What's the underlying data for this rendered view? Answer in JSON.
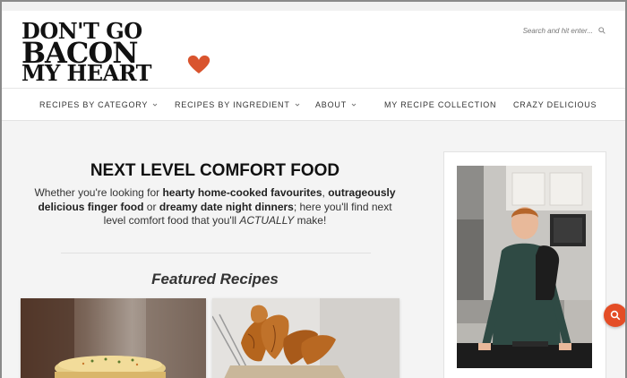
{
  "brand": {
    "logo_line1": "DON'T GO",
    "logo_line2": "BACON",
    "logo_line3": "MY HEART",
    "accent_color": "#d9542e"
  },
  "search": {
    "placeholder": "Search and hit enter...",
    "icon": "search-icon"
  },
  "nav": {
    "items": [
      {
        "label": "RECIPES BY CATEGORY",
        "has_dropdown": true
      },
      {
        "label": "RECIPES BY INGREDIENT",
        "has_dropdown": true
      },
      {
        "label": "ABOUT",
        "has_dropdown": true
      },
      {
        "label": "MY RECIPE COLLECTION",
        "has_dropdown": false
      },
      {
        "label": "CRAZY DELICIOUS",
        "has_dropdown": false
      }
    ]
  },
  "intro": {
    "title": "NEXT LEVEL COMFORT FOOD",
    "t1": "Whether you're looking for ",
    "b1": "hearty home-cooked favourites",
    "t2": ", ",
    "b2": "outrageously delicious finger food",
    "t3": " or ",
    "b3": "dreamy date night dinners",
    "t4": "; here you'll find next level comfort food that you'll ",
    "i1": "ACTUALLY",
    "t5": " make!"
  },
  "featured": {
    "heading": "Featured Recipes"
  },
  "fab": {
    "icon": "search-icon",
    "color": "#e44d26"
  }
}
